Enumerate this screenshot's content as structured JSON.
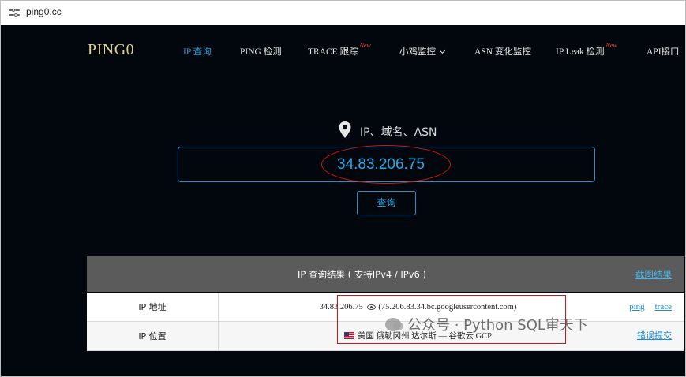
{
  "browser": {
    "url": "ping0.cc"
  },
  "site": {
    "logo": "PING0",
    "nav": [
      {
        "label": "IP 查询"
      },
      {
        "label": "PING 检测"
      },
      {
        "label": "TRACE 跟踪",
        "badge": "New"
      },
      {
        "label": "小鸡监控"
      },
      {
        "label": "ASN 变化监控"
      },
      {
        "label": "IP Leak 检测",
        "badge": "New"
      },
      {
        "label": "API接口"
      }
    ],
    "search": {
      "label": "IP、域名、ASN",
      "value": "34.83.206.75",
      "button": "查询"
    },
    "results": {
      "title": "IP 查询结果 ( 支持IPv4 / IPv6 )",
      "screenshot_link": "截图结果",
      "rows": [
        {
          "label": "IP 地址",
          "ip": "34.83.206.75",
          "host": "(75.206.83.34.bc.googleusercontent.com)",
          "links": [
            "ping",
            "trace"
          ]
        },
        {
          "label": "IP 位置",
          "location": "美国 俄勒冈州 达尔斯 — 谷歌云 GCP",
          "link": "错误提交"
        }
      ]
    }
  },
  "watermark": "公众号 · Python SQL审天下",
  "colors": {
    "accent": "#2aa8e8",
    "background": "#02070d",
    "highlight": "#d21414",
    "logo": "#e2d28a",
    "new_badge": "#ff4a4a"
  }
}
